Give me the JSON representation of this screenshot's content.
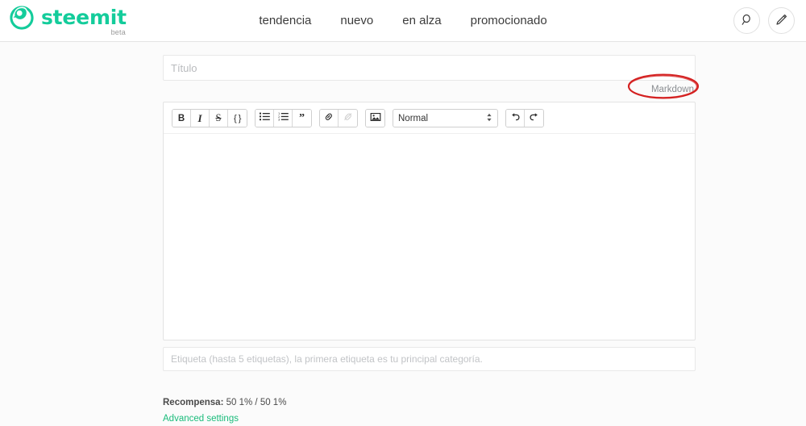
{
  "brand": {
    "name": "steemit",
    "tagline": "beta",
    "logo_icon": "steemit-logo-icon",
    "color": "#14cc9b"
  },
  "header": {
    "nav": [
      {
        "label": "tendencia",
        "name": "nav-item-tendencia"
      },
      {
        "label": "nuevo",
        "name": "nav-item-nuevo"
      },
      {
        "label": "en alza",
        "name": "nav-item-en-alza"
      },
      {
        "label": "promocionado",
        "name": "nav-item-promocionado"
      }
    ],
    "actions": [
      {
        "icon": "search-icon",
        "name": "search-button"
      },
      {
        "icon": "pencil-icon",
        "name": "new-post-button"
      }
    ]
  },
  "editor": {
    "title_placeholder": "Título",
    "title_value": "",
    "markdown_link": "Markdown",
    "body_value": "",
    "body_placeholder": "",
    "tags_placeholder": "Etiqueta (hasta 5 etiquetas), la primera etiqueta es tu principal categoría.",
    "tags_value": "",
    "toolbar": {
      "bold": "B",
      "italic": "I",
      "strikethrough": "S",
      "code": "{ }",
      "unordered_list": "unordered-list-icon",
      "ordered_list": "ordered-list-icon",
      "quote": "”",
      "link": "link-icon",
      "unlink": "unlink-icon",
      "image": "image-icon",
      "style_selected": "Normal",
      "style_options": [
        "Normal"
      ],
      "undo": "undo-icon",
      "redo": "redo-icon"
    }
  },
  "footer": {
    "reward_label": "Recompensa:",
    "reward_value": "50 1% / 50 1%",
    "advanced_settings": "Advanced settings",
    "link_color": "#1abc7b"
  },
  "annotation": {
    "shape": "ellipse",
    "color": "#d42020",
    "target": "Markdown"
  }
}
